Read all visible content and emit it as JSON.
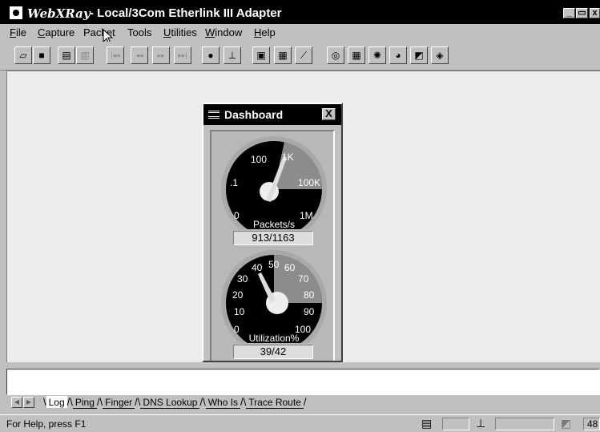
{
  "window": {
    "app_name": "WebXRay",
    "title": "- Local/3Com Etherlink III Adapter",
    "controls": {
      "minimize": "_",
      "maximize": "▭",
      "close": "x"
    }
  },
  "menubar": {
    "items": [
      {
        "label": "File",
        "mnemonic": "F",
        "rest": "ile"
      },
      {
        "label": "Capture",
        "mnemonic": "C",
        "rest": "apture"
      },
      {
        "label": "Packet",
        "mnemonic": "",
        "rest": "Packet"
      },
      {
        "label": "Tools",
        "mnemonic": "",
        "rest": "Tools"
      },
      {
        "label": "Utilities",
        "mnemonic": "U",
        "rest": "tilities"
      },
      {
        "label": "Window",
        "mnemonic": "W",
        "rest": "indow"
      },
      {
        "label": "Help",
        "mnemonic": "H",
        "rest": "elp"
      }
    ]
  },
  "toolbar": {
    "icons": [
      {
        "name": "open-icon",
        "glyph": "▱"
      },
      {
        "name": "save-icon",
        "glyph": "■"
      },
      {
        "name": "print-icon",
        "glyph": "▤"
      },
      {
        "name": "print-preview-icon",
        "glyph": "▥"
      },
      {
        "name": "first-icon",
        "glyph": "|◂◂"
      },
      {
        "name": "previous-icon",
        "glyph": "◂◂"
      },
      {
        "name": "next-icon",
        "glyph": "▸▸"
      },
      {
        "name": "last-icon",
        "glyph": "▸▸|"
      },
      {
        "name": "capture-icon",
        "glyph": "●"
      },
      {
        "name": "adapter-icon",
        "glyph": "⊥"
      },
      {
        "name": "host-table-icon",
        "glyph": "▣"
      },
      {
        "name": "host-list-icon",
        "glyph": "▦"
      },
      {
        "name": "graph-icon",
        "glyph": "⟋"
      },
      {
        "name": "dashboard-icon",
        "glyph": "◎"
      },
      {
        "name": "statistics-icon",
        "glyph": "▦"
      },
      {
        "name": "settings-icon",
        "glyph": "✺"
      },
      {
        "name": "pie-chart-icon",
        "glyph": "◕"
      },
      {
        "name": "filter-icon",
        "glyph": "◩"
      },
      {
        "name": "tag-icon",
        "glyph": "◈"
      }
    ]
  },
  "dashboard": {
    "title": "Dashboard",
    "close_label": "X",
    "packets_gauge": {
      "label": "Packets/s",
      "scale": [
        "0",
        ".1",
        "100",
        "1K",
        "100K",
        "1M"
      ],
      "readout": "913/1163"
    },
    "utilization_gauge": {
      "label": "Utilization%",
      "scale": [
        "0",
        "10",
        "20",
        "30",
        "40",
        "50",
        "60",
        "70",
        "80",
        "90",
        "100"
      ],
      "readout": "39/42"
    }
  },
  "tabs": {
    "items": [
      "Log",
      "Ping",
      "Finger",
      "DNS Lookup",
      "Who Is",
      "Trace Route"
    ],
    "active": "Log"
  },
  "status": {
    "help_text": "For Help, press F1",
    "right_value": "48"
  }
}
